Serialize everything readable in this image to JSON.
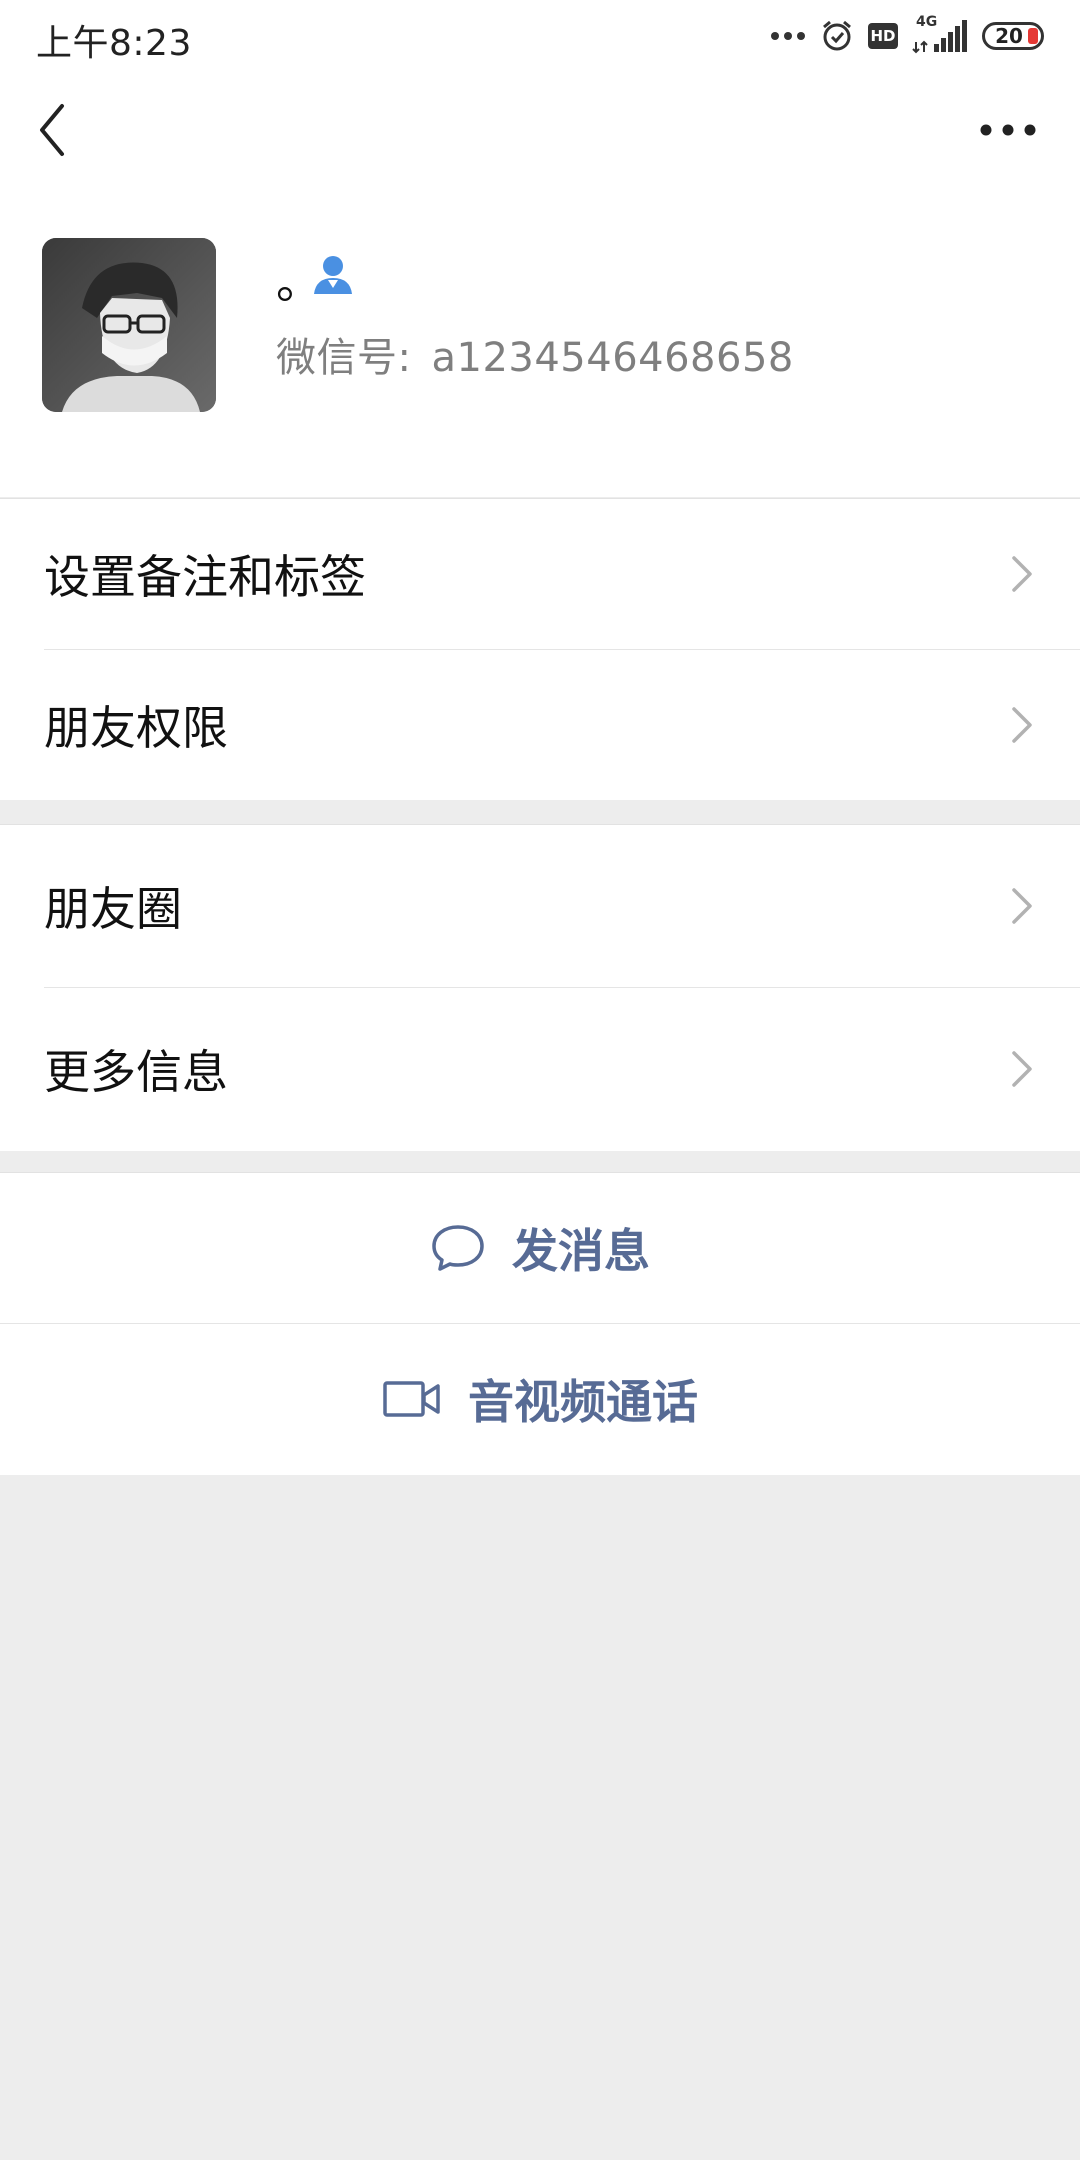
{
  "status_bar": {
    "time": "上午8:23",
    "network": "4G",
    "hd": "HD",
    "battery": "20"
  },
  "header": {
    "back_icon": "chevron-left-icon",
    "more_icon": "more-horizontal-icon"
  },
  "profile": {
    "nickname": "。",
    "wechat_id_label": "微信号:",
    "wechat_id_value": "a1234546468658",
    "badge_icon": "person-icon",
    "badge_color": "#4a90e2"
  },
  "menu_group_1": [
    {
      "label": "设置备注和标签"
    },
    {
      "label": "朋友权限"
    }
  ],
  "menu_group_2": [
    {
      "label": "朋友圈"
    },
    {
      "label": "更多信息"
    }
  ],
  "actions": {
    "send_message": "发消息",
    "video_call": "音视频通话",
    "accent_color": "#576b95"
  }
}
